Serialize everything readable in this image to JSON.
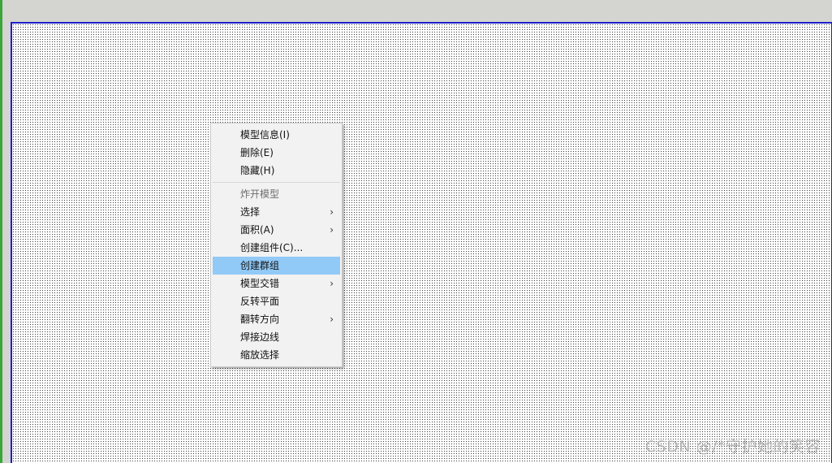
{
  "context_menu": {
    "items": [
      {
        "label": "模型信息(I)"
      },
      {
        "label": "删除(E)"
      },
      {
        "label": "隐藏(H)"
      },
      {
        "label": "炸开模型"
      },
      {
        "label": "选择",
        "submenu_arrow": "›"
      },
      {
        "label": "面积(A)",
        "submenu_arrow": "›"
      },
      {
        "label": "创建组件(C)..."
      },
      {
        "label": "创建群组"
      },
      {
        "label": "模型交错",
        "submenu_arrow": "›"
      },
      {
        "label": "反转平面"
      },
      {
        "label": "翻转方向",
        "submenu_arrow": "›"
      },
      {
        "label": "焊接边线"
      },
      {
        "label": "缩放选择"
      }
    ]
  },
  "watermark": "CSDN @/*守护她的笑容",
  "colors": {
    "viewport_border": "#1e1ec8",
    "menu_highlight": "#91c9f7",
    "left_strip": "#3aa63a"
  }
}
